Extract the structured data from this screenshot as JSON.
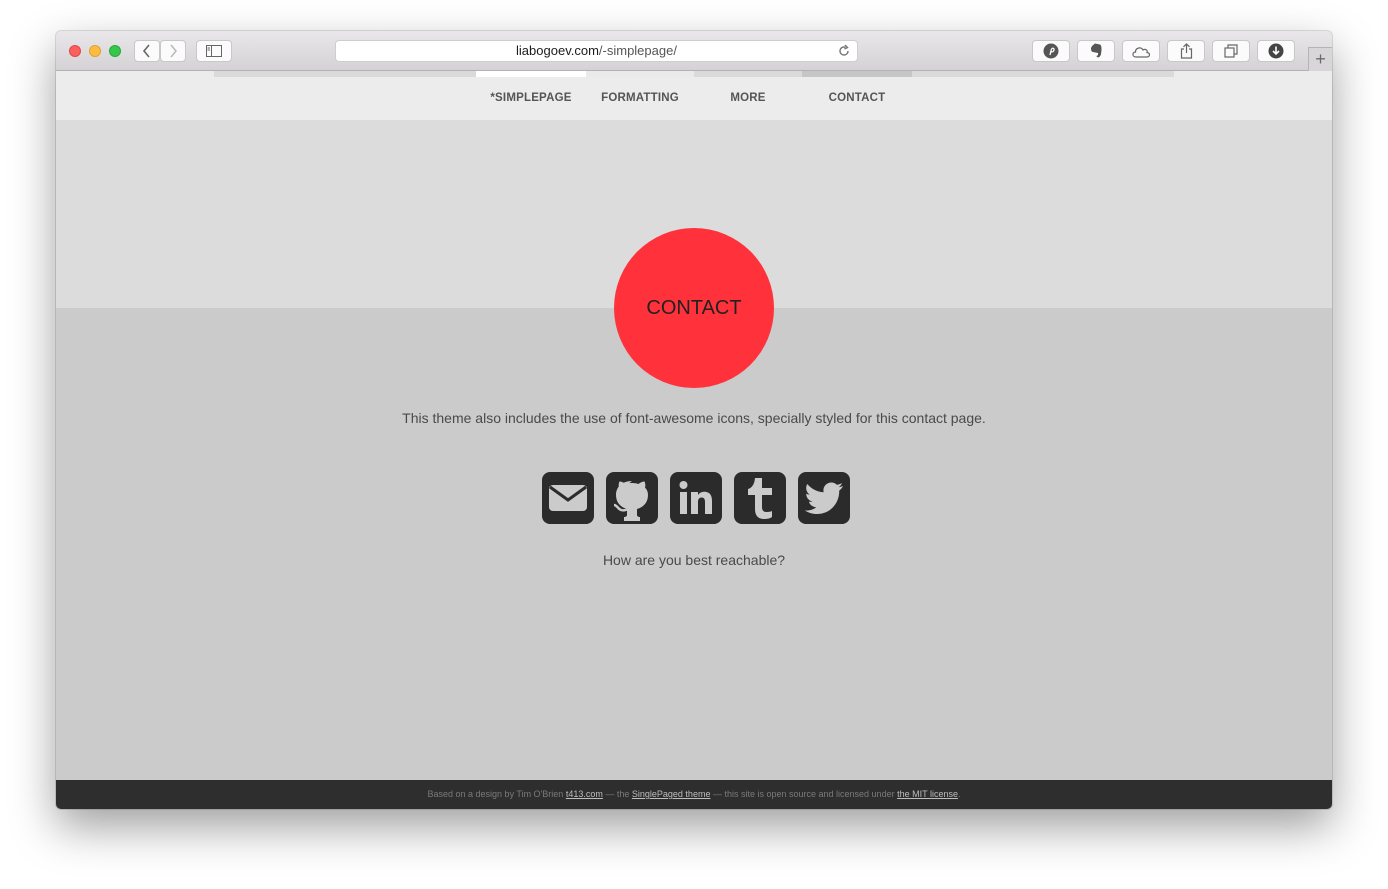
{
  "browser": {
    "url_host": "liabogoev.com",
    "url_path": "/-simplepage/",
    "toolbar_icons": [
      "pinterest-icon",
      "evernote-icon",
      "cloud-icon",
      "share-icon",
      "tabs-icon",
      "download-icon"
    ]
  },
  "nav": {
    "items": [
      {
        "label": "*SIMPLEPAGE"
      },
      {
        "label": "FORMATTING"
      },
      {
        "label": "MORE"
      },
      {
        "label": "CONTACT"
      }
    ]
  },
  "hero": {
    "title": "CONTACT"
  },
  "contact": {
    "description": "This theme also includes the use of font-awesome icons, specially styled for this contact page.",
    "icons": [
      "envelope-icon",
      "github-icon",
      "linkedin-icon",
      "tumblr-icon",
      "twitter-icon"
    ],
    "prompt": "How are you best reachable?"
  },
  "footer": {
    "prefix": "Based on a design by Tim O'Brien",
    "link1": "t413.com",
    "sep1": "— the",
    "link2": "SinglePaged theme",
    "sep2": "— this site is open source and licensed under",
    "link3": "the MIT license",
    "suffix": "."
  },
  "colors": {
    "accent": "#ff323c",
    "hero_bg": "#dcdcdc",
    "content_bg": "#cbcbcb",
    "nav_bg": "#ececec",
    "footer_bg": "#2f2e2e",
    "icon_bg": "#2b2b2b"
  }
}
